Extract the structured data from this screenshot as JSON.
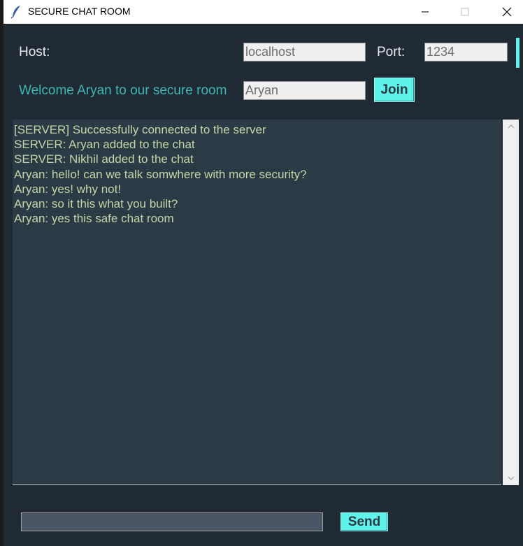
{
  "window": {
    "title": "SECURE CHAT ROOM"
  },
  "connection": {
    "host_label": "Host:",
    "host_value": "localhost",
    "port_label": "Port:",
    "port_value": "1234"
  },
  "user": {
    "welcome_text": "Welcome Aryan to our secure room",
    "name_value": "Aryan",
    "join_label": "Join"
  },
  "chat": {
    "messages": [
      "[SERVER] Successfully connected to the server",
      "SERVER: Aryan added to the chat",
      "SERVER: Nikhil added to the chat",
      "Aryan: hello! can we talk somwhere with more security?",
      "Aryan: yes! why not!",
      "Aryan: so it this what you built?",
      "Aryan: yes this safe chat room"
    ]
  },
  "composer": {
    "message_value": "",
    "send_label": "Send"
  },
  "icons": {
    "app": "feather-icon",
    "minimize": "minimize-icon",
    "maximize": "maximize-icon",
    "close": "close-icon",
    "scroll_up": "chevron-up-icon",
    "scroll_down": "chevron-down-icon"
  },
  "colors": {
    "background": "#1f2a35",
    "accent": "#5ff2ea",
    "welcome_text": "#3fb7b2",
    "chat_background": "#2b3a44",
    "chat_text": "#c4d6a8"
  }
}
